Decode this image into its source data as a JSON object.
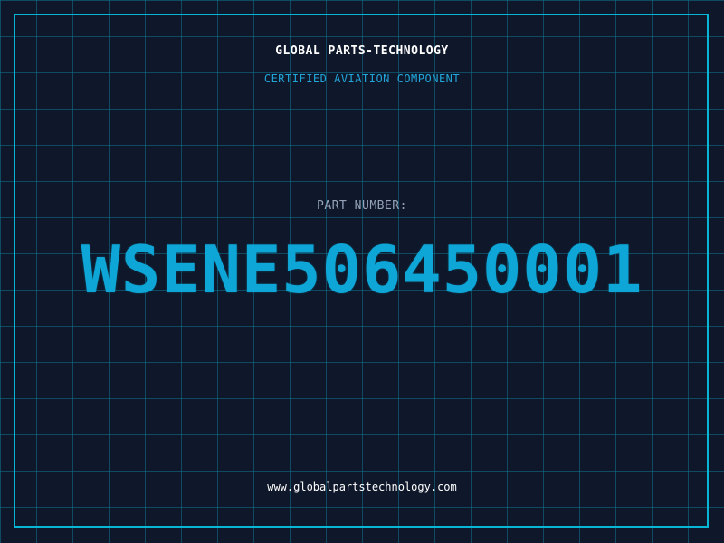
{
  "header": {
    "company_name": "GLOBAL PARTS-TECHNOLOGY",
    "subtitle": "CERTIFIED AVIATION COMPONENT"
  },
  "part": {
    "label": "PART NUMBER:",
    "number": "WSENE506450001"
  },
  "footer": {
    "website": "www.globalpartstechnology.com"
  },
  "colors": {
    "background": "#0f172a",
    "grid": "#0e7490",
    "frame": "#06b6d4",
    "accent": "#0ea5d7",
    "label": "#94a3b8",
    "text": "#ffffff"
  }
}
